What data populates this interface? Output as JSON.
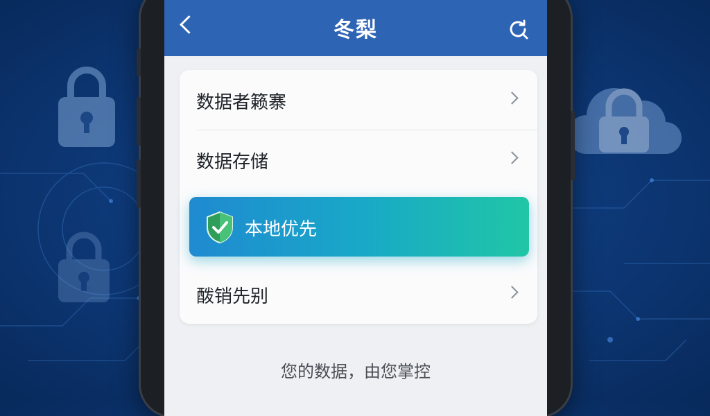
{
  "header": {
    "title": "冬梨",
    "back_icon": "chevron-left-icon",
    "refresh_icon": "refresh-icon"
  },
  "menu": {
    "items": [
      {
        "label": "数据者籁寨",
        "icon": "chevron-right-icon"
      },
      {
        "label": "数据存储",
        "icon": "chevron-right-icon"
      },
      {
        "label": "本地优先",
        "icon": "shield-check-icon",
        "highlighted": true
      },
      {
        "label": "酦销先别",
        "icon": "chevron-right-icon"
      }
    ]
  },
  "footer": {
    "text": "您的数据，由您掌控"
  },
  "colors": {
    "appbar": "#2e64b4",
    "highlight_start": "#1f8ad0",
    "highlight_end": "#20c6a6",
    "shield": "#3fb86a"
  }
}
